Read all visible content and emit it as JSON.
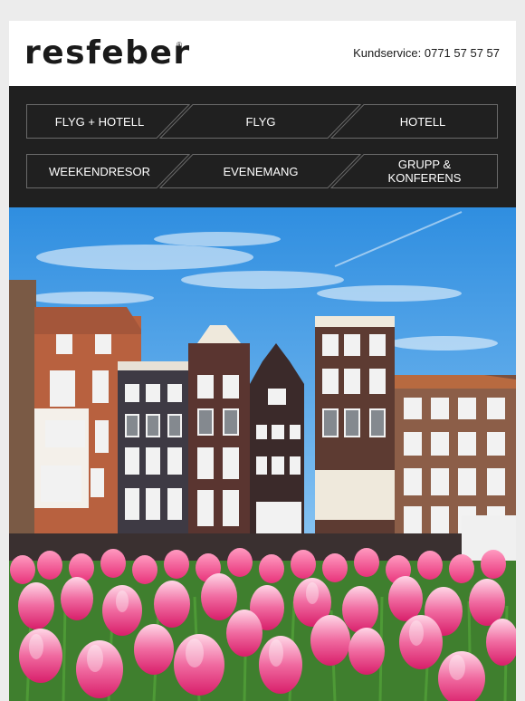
{
  "brand": {
    "name": "resfeber",
    "trademark": "®"
  },
  "support": {
    "text": "Kundservice: 0771 57 57 57"
  },
  "nav": {
    "row1": [
      "FLYG + HOTELL",
      "FLYG",
      "HOTELL"
    ],
    "row2": [
      "WEEKENDRESOR",
      "EVENEMANG",
      "GRUPP & KONFERENS"
    ]
  },
  "colors": {
    "nav_bg": "#202020",
    "nav_border": "#6a6a6a",
    "sky": "#4a9fe0",
    "tulip_pink": "#e8327a"
  },
  "icons": {
    "hero_image": "amsterdam-canal-houses-with-tulips"
  }
}
